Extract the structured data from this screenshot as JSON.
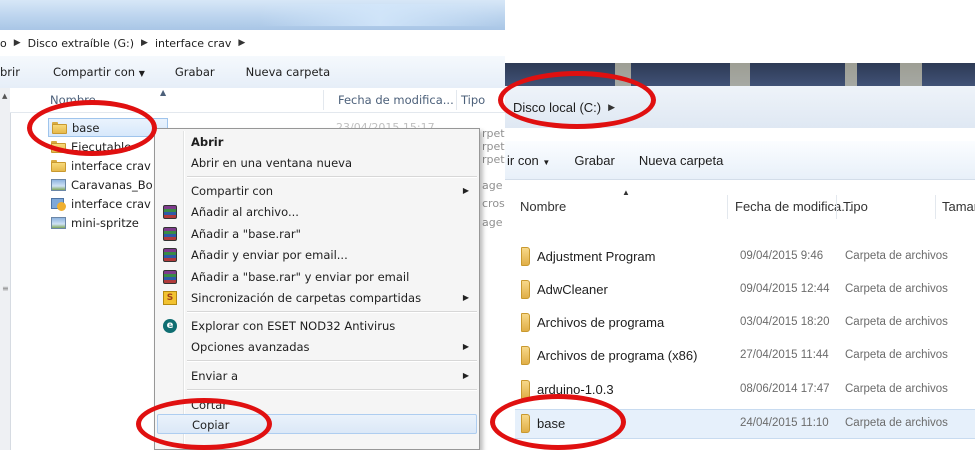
{
  "left_window": {
    "breadcrumb": {
      "lead": "o",
      "drive": "Disco extraíble (G:)",
      "folder": "interface crav"
    },
    "toolbar": {
      "open_cut": "brir",
      "share": "Compartir con",
      "burn": "Grabar",
      "new_folder": "Nueva carpeta"
    },
    "columns": {
      "name": "Nombre",
      "date": "Fecha de modifica...",
      "type": "Tipo"
    },
    "files": [
      {
        "name": "base",
        "icon": "folder-icon"
      },
      {
        "name": "Ejecutable",
        "icon": "folder-icon"
      },
      {
        "name": "interface crav",
        "icon": "folder-icon"
      },
      {
        "name": "Caravanas_Bo",
        "icon": "image-icon"
      },
      {
        "name": "interface crav",
        "icon": "application-icon"
      },
      {
        "name": "mini-spritze",
        "icon": "image-icon"
      }
    ],
    "partial_type_text": [
      "rpet",
      "rpet",
      "rpet",
      "age",
      "cros",
      "age"
    ],
    "partial_date_text": "23/04/2015 15:17"
  },
  "context_menu": {
    "items": {
      "open": "Abrir",
      "open_new_window": "Abrir en una ventana nueva",
      "share_with": "Compartir con",
      "add_to_archive": "Añadir al archivo...",
      "add_to_rar": "Añadir a \"base.rar\"",
      "add_email": "Añadir y enviar por email...",
      "add_rar_email": "Añadir a \"base.rar\" y enviar por email",
      "sync_folders": "Sincronización de carpetas compartidas",
      "eset_scan": "Explorar con ESET NOD32 Antivirus",
      "advanced": "Opciones avanzadas",
      "send_to": "Enviar a",
      "cut": "Cortar",
      "copy": "Copiar"
    },
    "highlighted": "Copiar"
  },
  "right_window": {
    "breadcrumb": {
      "drive": "Disco local (C:)"
    },
    "toolbar": {
      "share": "ir con",
      "burn": "Grabar",
      "new_folder": "Nueva carpeta"
    },
    "columns": {
      "name": "Nombre",
      "date": "Fecha de modifica...",
      "type": "Tipo",
      "size": "Tamañ"
    },
    "rows": [
      {
        "name": "Adjustment Program",
        "date": "09/04/2015 9:46",
        "type": "Carpeta de archivos"
      },
      {
        "name": "AdwCleaner",
        "date": "09/04/2015 12:44",
        "type": "Carpeta de archivos"
      },
      {
        "name": "Archivos de programa",
        "date": "03/04/2015 18:20",
        "type": "Carpeta de archivos"
      },
      {
        "name": "Archivos de programa (x86)",
        "date": "27/04/2015 11:44",
        "type": "Carpeta de archivos"
      },
      {
        "name": "arduino-1.0.3",
        "date": "08/06/2014 17:47",
        "type": "Carpeta de archivos"
      },
      {
        "name": "base",
        "date": "24/04/2015 11:10",
        "type": "Carpeta de archivos"
      }
    ]
  },
  "colors": {
    "annotation_red": "#e01010",
    "selection_blue": "#d7e8fb",
    "title_bar_dark": "#2d3a55"
  }
}
